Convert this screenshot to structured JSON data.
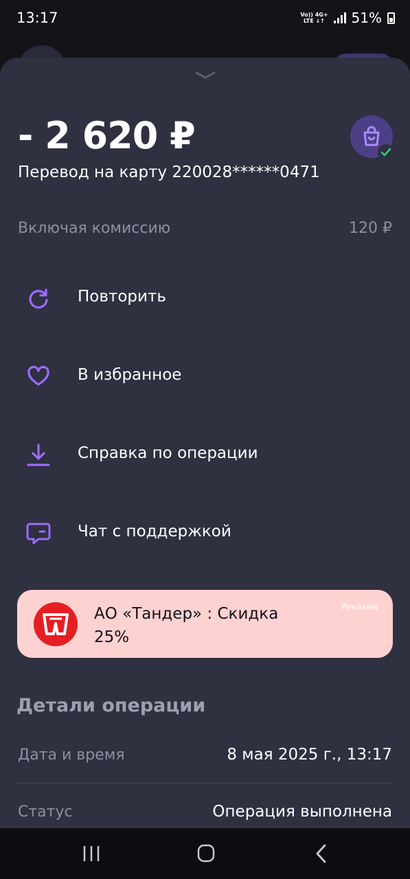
{
  "status_bar": {
    "time": "13:17",
    "net_line1": "Vo)) 4G+",
    "net_line2": "LTE ↓↑",
    "battery": "51%"
  },
  "header": {
    "amount": "- 2 620 ₽",
    "subtitle": "Перевод на карту 220028******0471"
  },
  "fee": {
    "label": "Включая комиссию",
    "value": "120 ₽"
  },
  "actions": [
    {
      "label": "Повторить",
      "icon": "repeat-icon"
    },
    {
      "label": "В избранное",
      "icon": "heart-icon"
    },
    {
      "label": "Справка по операции",
      "icon": "download-icon"
    },
    {
      "label": "Чат с поддержкой",
      "icon": "chat-icon"
    }
  ],
  "promo": {
    "text": "АО «Тандер» : Скидка 25%",
    "ad_label": "Реклама",
    "logo_icon": "magnit-logo-icon"
  },
  "details": {
    "title": "Детали операции",
    "rows": [
      {
        "label": "Дата и время",
        "value": "8 мая 2025 г., 13:17"
      },
      {
        "label": "Статус",
        "value": "Операция выполнена"
      }
    ]
  },
  "colors": {
    "sheet_bg": "#2f3040",
    "accent": "#9b6cff",
    "promo_bg": "#ffd2d2",
    "promo_logo": "#e51f24",
    "success": "#2ecf7a"
  }
}
